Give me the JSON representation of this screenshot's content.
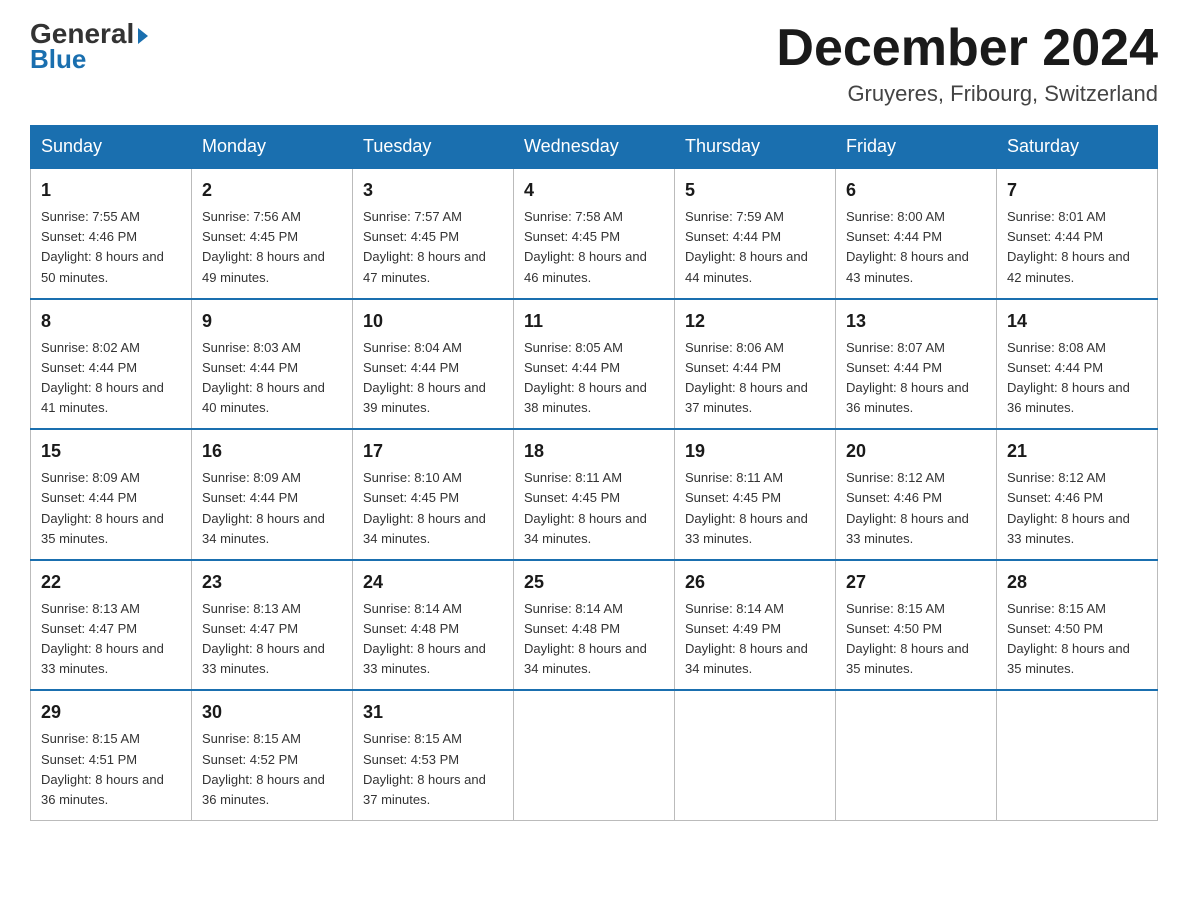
{
  "header": {
    "logo_line1_general": "General",
    "logo_line1_blue": "Blue",
    "month_title": "December 2024",
    "location": "Gruyeres, Fribourg, Switzerland"
  },
  "days_of_week": [
    "Sunday",
    "Monday",
    "Tuesday",
    "Wednesday",
    "Thursday",
    "Friday",
    "Saturday"
  ],
  "weeks": [
    [
      {
        "day": "1",
        "sunrise": "7:55 AM",
        "sunset": "4:46 PM",
        "daylight": "8 hours and 50 minutes."
      },
      {
        "day": "2",
        "sunrise": "7:56 AM",
        "sunset": "4:45 PM",
        "daylight": "8 hours and 49 minutes."
      },
      {
        "day": "3",
        "sunrise": "7:57 AM",
        "sunset": "4:45 PM",
        "daylight": "8 hours and 47 minutes."
      },
      {
        "day": "4",
        "sunrise": "7:58 AM",
        "sunset": "4:45 PM",
        "daylight": "8 hours and 46 minutes."
      },
      {
        "day": "5",
        "sunrise": "7:59 AM",
        "sunset": "4:44 PM",
        "daylight": "8 hours and 44 minutes."
      },
      {
        "day": "6",
        "sunrise": "8:00 AM",
        "sunset": "4:44 PM",
        "daylight": "8 hours and 43 minutes."
      },
      {
        "day": "7",
        "sunrise": "8:01 AM",
        "sunset": "4:44 PM",
        "daylight": "8 hours and 42 minutes."
      }
    ],
    [
      {
        "day": "8",
        "sunrise": "8:02 AM",
        "sunset": "4:44 PM",
        "daylight": "8 hours and 41 minutes."
      },
      {
        "day": "9",
        "sunrise": "8:03 AM",
        "sunset": "4:44 PM",
        "daylight": "8 hours and 40 minutes."
      },
      {
        "day": "10",
        "sunrise": "8:04 AM",
        "sunset": "4:44 PM",
        "daylight": "8 hours and 39 minutes."
      },
      {
        "day": "11",
        "sunrise": "8:05 AM",
        "sunset": "4:44 PM",
        "daylight": "8 hours and 38 minutes."
      },
      {
        "day": "12",
        "sunrise": "8:06 AM",
        "sunset": "4:44 PM",
        "daylight": "8 hours and 37 minutes."
      },
      {
        "day": "13",
        "sunrise": "8:07 AM",
        "sunset": "4:44 PM",
        "daylight": "8 hours and 36 minutes."
      },
      {
        "day": "14",
        "sunrise": "8:08 AM",
        "sunset": "4:44 PM",
        "daylight": "8 hours and 36 minutes."
      }
    ],
    [
      {
        "day": "15",
        "sunrise": "8:09 AM",
        "sunset": "4:44 PM",
        "daylight": "8 hours and 35 minutes."
      },
      {
        "day": "16",
        "sunrise": "8:09 AM",
        "sunset": "4:44 PM",
        "daylight": "8 hours and 34 minutes."
      },
      {
        "day": "17",
        "sunrise": "8:10 AM",
        "sunset": "4:45 PM",
        "daylight": "8 hours and 34 minutes."
      },
      {
        "day": "18",
        "sunrise": "8:11 AM",
        "sunset": "4:45 PM",
        "daylight": "8 hours and 34 minutes."
      },
      {
        "day": "19",
        "sunrise": "8:11 AM",
        "sunset": "4:45 PM",
        "daylight": "8 hours and 33 minutes."
      },
      {
        "day": "20",
        "sunrise": "8:12 AM",
        "sunset": "4:46 PM",
        "daylight": "8 hours and 33 minutes."
      },
      {
        "day": "21",
        "sunrise": "8:12 AM",
        "sunset": "4:46 PM",
        "daylight": "8 hours and 33 minutes."
      }
    ],
    [
      {
        "day": "22",
        "sunrise": "8:13 AM",
        "sunset": "4:47 PM",
        "daylight": "8 hours and 33 minutes."
      },
      {
        "day": "23",
        "sunrise": "8:13 AM",
        "sunset": "4:47 PM",
        "daylight": "8 hours and 33 minutes."
      },
      {
        "day": "24",
        "sunrise": "8:14 AM",
        "sunset": "4:48 PM",
        "daylight": "8 hours and 33 minutes."
      },
      {
        "day": "25",
        "sunrise": "8:14 AM",
        "sunset": "4:48 PM",
        "daylight": "8 hours and 34 minutes."
      },
      {
        "day": "26",
        "sunrise": "8:14 AM",
        "sunset": "4:49 PM",
        "daylight": "8 hours and 34 minutes."
      },
      {
        "day": "27",
        "sunrise": "8:15 AM",
        "sunset": "4:50 PM",
        "daylight": "8 hours and 35 minutes."
      },
      {
        "day": "28",
        "sunrise": "8:15 AM",
        "sunset": "4:50 PM",
        "daylight": "8 hours and 35 minutes."
      }
    ],
    [
      {
        "day": "29",
        "sunrise": "8:15 AM",
        "sunset": "4:51 PM",
        "daylight": "8 hours and 36 minutes."
      },
      {
        "day": "30",
        "sunrise": "8:15 AM",
        "sunset": "4:52 PM",
        "daylight": "8 hours and 36 minutes."
      },
      {
        "day": "31",
        "sunrise": "8:15 AM",
        "sunset": "4:53 PM",
        "daylight": "8 hours and 37 minutes."
      },
      null,
      null,
      null,
      null
    ]
  ],
  "labels": {
    "sunrise": "Sunrise:",
    "sunset": "Sunset:",
    "daylight": "Daylight:"
  }
}
